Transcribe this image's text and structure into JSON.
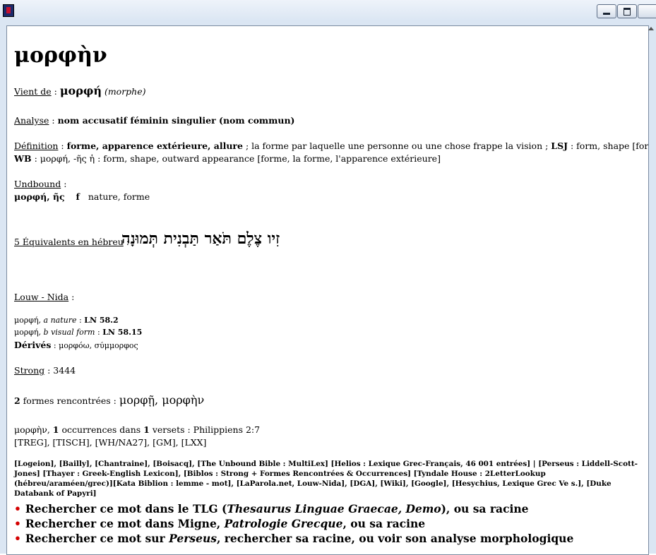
{
  "window": {
    "icon": "app-icon",
    "minimize": "minimize-icon",
    "maximize": "maximize-icon",
    "close": "close-icon"
  },
  "headword": "μορφὴν",
  "origin": {
    "label": "Vient de",
    "sep": " : ",
    "word": "μορφή",
    "translit": "(morphe)"
  },
  "analysis": {
    "label": "Analyse",
    "sep": " : ",
    "value": "nom accusatif féminin singulier (nom commun)"
  },
  "definition": {
    "label": "Définition",
    "sep": " : ",
    "bold": "forme, apparence extérieure, allure",
    "rest": " ; la forme par laquelle une personne ou une chose frappe la vision ; ",
    "lsj_label": "LSJ",
    "lsj": " : form, shape [forme, la forme];",
    "wb_label": "WB",
    "wb": " : μορφή, -ῆς ἡ : form, shape, outward appearance [forme, la forme, l'apparence extérieure]"
  },
  "undbound": {
    "label": "Undbound",
    "sep": " :",
    "word": "μορφή, ῆς",
    "gender": "f",
    "gloss": "nature, forme"
  },
  "hebrew": {
    "label": "5 Équivalents en hébreu",
    "sep": " : ",
    "words": "זִיו צֶלֶם תֹּאַר תַּבְנִית תְּמוּנָה"
  },
  "louw_nida": {
    "label": "Louw - Nida",
    "sep": " :",
    "entries": [
      {
        "word": "μορφή",
        "sense": ", a nature",
        "code_label": " : ",
        "code": "LN 58.2"
      },
      {
        "word": "μορφή",
        "sense": ", b visual form",
        "code_label": " : ",
        "code": "LN 58.15"
      }
    ],
    "derived_label": "Dérivés",
    "derived": " : μορφόω, σύμμορφος"
  },
  "strong": {
    "label": "Strong",
    "value": " : 3444"
  },
  "forms": {
    "count": "2",
    "label": " formes rencontrées : ",
    "words": "μορφῇ, μορφὴν"
  },
  "occurrences": {
    "word": "μορφὴν",
    "count": "1",
    "text1": " occurrences dans ",
    "verses": "1",
    "text2": " versets : Philippiens 2:7",
    "editions": "[TREG], [TISCH], [WH/NA27], [GM], [LXX]"
  },
  "links": "[Logeion], [Bailly], [Chantraine], [Boisacq], [The Unbound Bible : MultiLex] [Helios : Lexique Grec-Français, 46 001 entrées] | [Perseus : Liddell-Scott-Jones] [Thayer : Greek-English Lexicon], [Biblos : Strong + Formes Rencontrées & Occurrences] [Tyndale House : 2LetterLookup (hébreu/araméen/grec)][Kata Biblion : lemme - mot], [LaParola.net, Louw-Nida], [DGA], [Wiki], [Google], [Hesychius, Lexique Grec Ve s.], [Duke Databank of Papyri]",
  "search": [
    {
      "pre": "Rechercher ce mot dans le TLG (",
      "it": "Thesaurus Linguae Graecae, Demo",
      "post": "), ou sa racine"
    },
    {
      "pre": "Rechercher ce mot dans Migne, ",
      "it": "Patrologie Grecque",
      "post": ", ou sa racine"
    },
    {
      "pre": "Rechercher ce mot sur ",
      "it": "Perseus",
      "post": ", rechercher sa racine, ou voir son analyse morphologique"
    }
  ],
  "colors": {
    "bullet": "#d40000",
    "titlebar": "#dbe6f3"
  }
}
